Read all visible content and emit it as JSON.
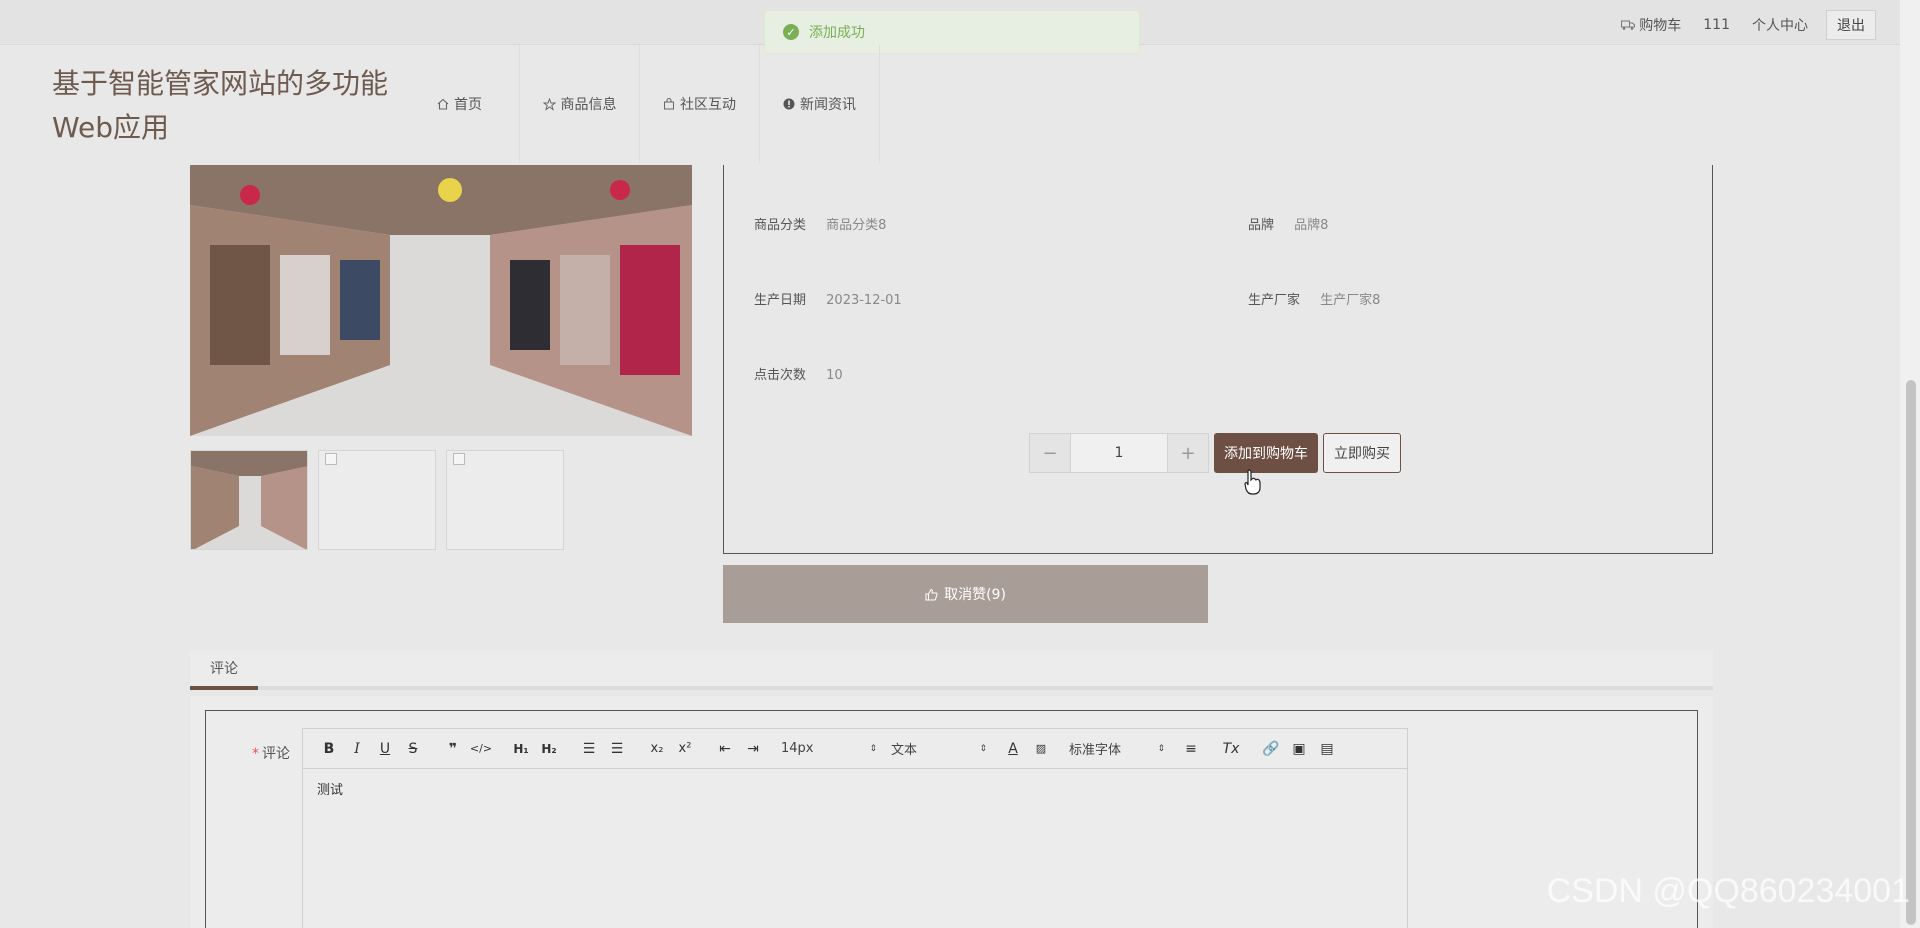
{
  "topbar": {
    "cart_label": "购物车",
    "username": "111",
    "profile_label": "个人中心",
    "logout_label": "退出"
  },
  "toast": {
    "message": "添加成功"
  },
  "header": {
    "title": "基于智能管家网站的多功能Web应用",
    "nav": [
      {
        "label": "首页",
        "icon": "home-icon"
      },
      {
        "label": "商品信息",
        "icon": "star-icon"
      },
      {
        "label": "社区互动",
        "icon": "bag-icon"
      },
      {
        "label": "新闻资讯",
        "icon": "alert-icon"
      }
    ]
  },
  "product": {
    "fields": {
      "category_label": "商品分类",
      "category_value": "商品分类8",
      "brand_label": "品牌",
      "brand_value": "品牌8",
      "date_label": "生产日期",
      "date_value": "2023-12-01",
      "maker_label": "生产厂家",
      "maker_value": "生产厂家8",
      "clicks_label": "点击次数",
      "clicks_value": "10"
    },
    "quantity": "1",
    "qty_minus": "−",
    "qty_plus": "+",
    "add_cart_label": "添加到购物车",
    "buy_now_label": "立即购买",
    "unlike_label": "取消赞(9)"
  },
  "comments": {
    "tab_label": "评论",
    "field_label": "评论",
    "required_mark": "*",
    "content": "测试",
    "toolbar": {
      "font_size": "14px",
      "text_style": "文本",
      "font_family": "标准字体"
    }
  },
  "watermark": "CSDN @QQ860234001",
  "colors": {
    "accent": "#6d4f44",
    "toast_green": "#7ab055",
    "like_bar": "#a99d98"
  }
}
